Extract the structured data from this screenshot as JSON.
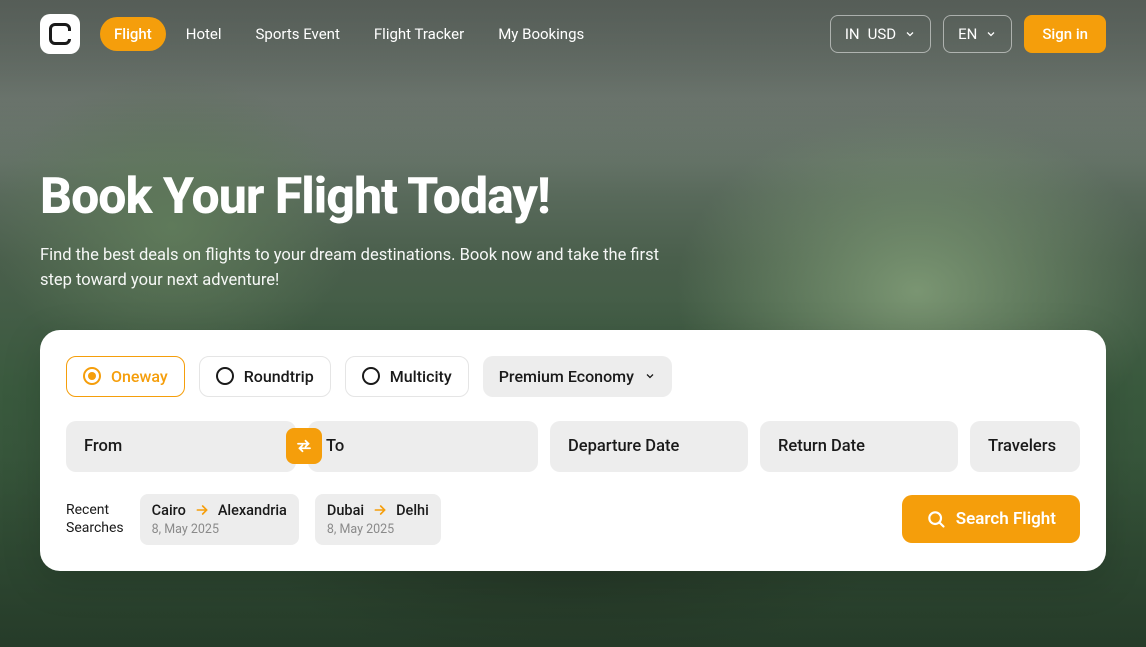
{
  "nav": {
    "items": [
      {
        "label": "Flight",
        "active": true
      },
      {
        "label": "Hotel"
      },
      {
        "label": "Sports Event"
      },
      {
        "label": "Flight Tracker"
      },
      {
        "label": "My Bookings"
      }
    ]
  },
  "header": {
    "region": "IN",
    "currency": "USD",
    "language": "EN",
    "signin": "Sign in"
  },
  "hero": {
    "title": "Book Your Flight Today!",
    "subtitle": "Find the best deals on flights to your dream destinations. Book now and take the first step toward your next adventure!"
  },
  "trip": {
    "options": [
      {
        "label": "Oneway",
        "selected": true
      },
      {
        "label": "Roundtrip"
      },
      {
        "label": "Multicity"
      }
    ],
    "class_selected": "Premium Economy"
  },
  "fields": {
    "from": "From",
    "to": "To",
    "departure": "Departure Date",
    "return": "Return Date",
    "travelers": "Travelers"
  },
  "recent": {
    "label_line1": "Recent",
    "label_line2": "Searches",
    "items": [
      {
        "from": "Cairo",
        "to": "Alexandria",
        "date": "8, May 2025"
      },
      {
        "from": "Dubai",
        "to": "Delhi",
        "date": "8, May 2025"
      }
    ]
  },
  "search_button": "Search Flight",
  "colors": {
    "accent": "#F59E0B"
  }
}
